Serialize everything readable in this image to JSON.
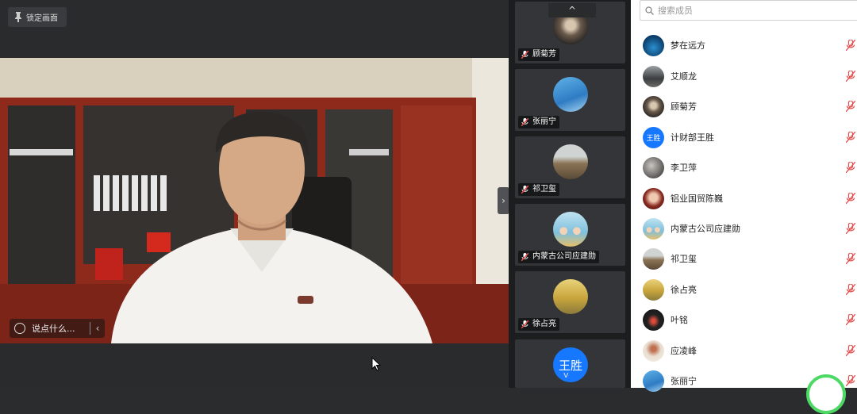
{
  "stage": {
    "lock_label": "锁定画面",
    "chat_placeholder": "说点什么..."
  },
  "strip": {
    "tiles": [
      {
        "name": "顾菊芳",
        "avatar": "photo-dark"
      },
      {
        "name": "张丽宁",
        "avatar": "photo-blue-sky"
      },
      {
        "name": "祁卫玺",
        "avatar": "photo-building"
      },
      {
        "name": "内蒙古公司应建勋",
        "avatar": "photo-cartoon-kids"
      },
      {
        "name": "徐占亮",
        "avatar": "photo-yellow-field"
      },
      {
        "name": "王胜",
        "avatar": "text-avatar"
      }
    ],
    "tile_avatar_text": "王胜"
  },
  "panel": {
    "search_placeholder": "搜索成员",
    "members": [
      {
        "name": "梦在远方",
        "avatar_text": ""
      },
      {
        "name": "艾顺龙",
        "avatar_text": ""
      },
      {
        "name": "顾菊芳",
        "avatar_text": ""
      },
      {
        "name": "计财部王胜",
        "avatar_text": "王胜"
      },
      {
        "name": "李卫萍",
        "avatar_text": ""
      },
      {
        "name": "铝业国贸陈巍",
        "avatar_text": ""
      },
      {
        "name": "内蒙古公司应建勋",
        "avatar_text": ""
      },
      {
        "name": "祁卫玺",
        "avatar_text": ""
      },
      {
        "name": "徐占亮",
        "avatar_text": ""
      },
      {
        "name": "叶铭",
        "avatar_text": ""
      },
      {
        "name": "应凌峰",
        "avatar_text": ""
      },
      {
        "name": "张丽宁",
        "avatar_text": ""
      }
    ]
  },
  "colors": {
    "accent_blue": "#1677ff",
    "mute_red": "#e54d4d",
    "ring_green": "#4cd964"
  }
}
